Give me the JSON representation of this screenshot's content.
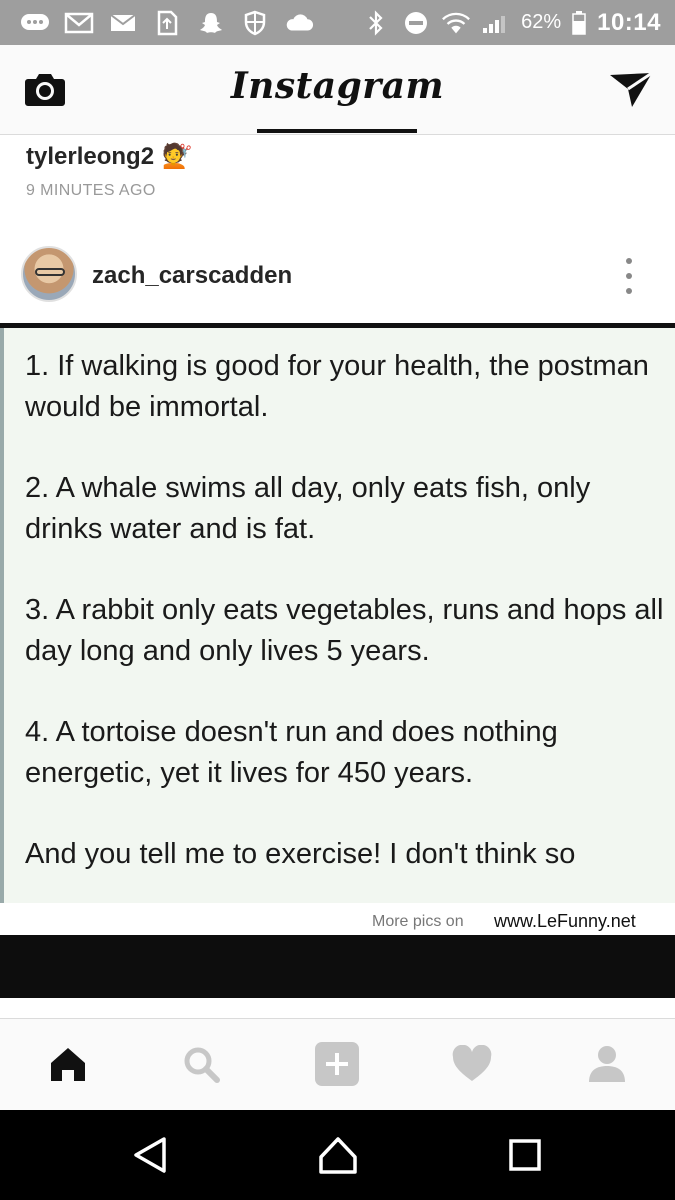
{
  "status_bar": {
    "icons": [
      "chat-icon",
      "gmail-icon",
      "mail-icon",
      "sim-icon",
      "snapchat-icon",
      "shield-icon",
      "cloud-icon",
      "bluetooth-icon",
      "dnd-icon",
      "wifi-icon",
      "signal-icon",
      "battery-icon"
    ],
    "battery_percent": "62%",
    "time": "10:14"
  },
  "app_bar": {
    "title": "Instagram"
  },
  "share": {
    "username": "tylerleong2",
    "emoji": "💇",
    "time_ago": "9 MINUTES AGO"
  },
  "post": {
    "username": "zach_carscadden",
    "image_text": {
      "item1": "1. If walking is good for your health, the postman would be immortal.",
      "item2": "2. A whale swims all day, only eats fish, only drinks water and is fat.",
      "item3": "3. A rabbit only eats vegetables, runs and hops all day long and only lives 5 years.",
      "item4": "4. A tortoise doesn't run and does nothing energetic, yet it lives for 450 years.",
      "closing": "And you tell me to exercise! I don't think so"
    },
    "watermark_prefix": "More pics on",
    "watermark_site": "www.LeFunny.net"
  },
  "bottom_nav": [
    "home-icon",
    "search-icon",
    "add-post-icon",
    "heart-icon",
    "profile-icon"
  ],
  "system_nav": [
    "back-icon",
    "home-circle-icon",
    "recents-icon"
  ],
  "colors": {
    "status_bar_bg": "#9e9e9e",
    "header_bg": "#fafafa",
    "post_image_bg": "#f2f7f1"
  }
}
